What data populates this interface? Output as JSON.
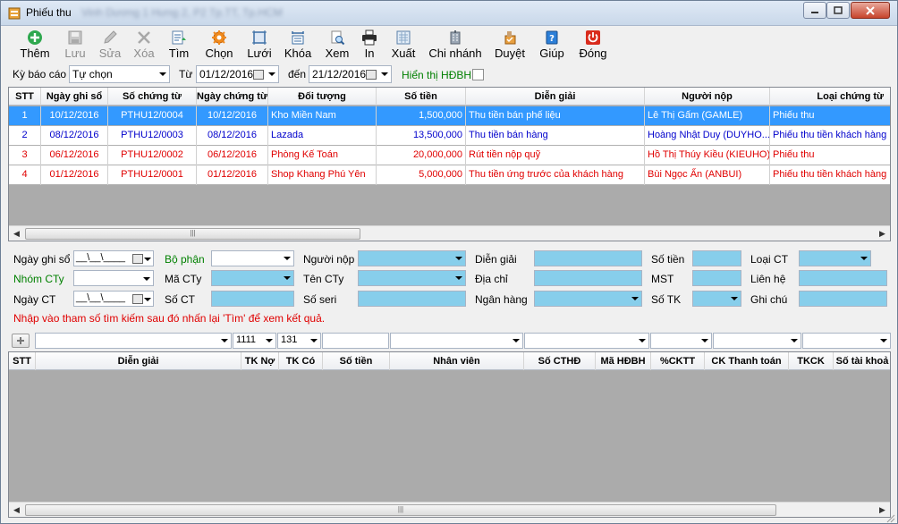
{
  "window": {
    "title": "Phiếu thu",
    "subtitle_blurred": "Vinh Dương 1 Hưng 2, P2 Tp.TT, Tp.HCM"
  },
  "toolbar": [
    {
      "label": "Thêm",
      "icon": "add-icon",
      "enabled": true
    },
    {
      "label": "Lưu",
      "icon": "save-icon",
      "enabled": false
    },
    {
      "label": "Sửa",
      "icon": "edit-icon",
      "enabled": false
    },
    {
      "label": "Xóa",
      "icon": "delete-icon",
      "enabled": false
    },
    {
      "label": "Tìm",
      "icon": "find-icon",
      "enabled": true
    },
    {
      "label": "Chọn",
      "icon": "gear-icon",
      "enabled": true
    },
    {
      "label": "Lưới",
      "icon": "grid-icon",
      "enabled": true
    },
    {
      "label": "Khóa",
      "icon": "lock-icon",
      "enabled": true
    },
    {
      "label": "Xem",
      "icon": "preview-icon",
      "enabled": true
    },
    {
      "label": "In",
      "icon": "printer-icon",
      "enabled": true
    },
    {
      "label": "Xuất",
      "icon": "export-icon",
      "enabled": true
    },
    {
      "label": "Chi nhánh",
      "icon": "branch-icon",
      "enabled": true
    },
    {
      "label": "Duyệt",
      "icon": "approve-icon",
      "enabled": true
    },
    {
      "label": "Giúp",
      "icon": "help-icon",
      "enabled": true
    },
    {
      "label": "Đóng",
      "icon": "power-icon",
      "enabled": true
    }
  ],
  "filter": {
    "period_label": "Kỳ báo cáo",
    "period_value": "Tự chọn",
    "from_label": "Từ",
    "from_value": "01/12/2016",
    "to_label": "đến",
    "to_value": "21/12/2016",
    "show_invoice_label": "Hiển thị HĐBH",
    "show_invoice_checked": false
  },
  "main_grid": {
    "columns": [
      "STT",
      "Ngày ghi sổ",
      "Số chứng từ",
      "Ngày chứng từ",
      "Đối tượng",
      "Số tiền",
      "Diễn giải",
      "Người nộp",
      "Loại chứng từ"
    ],
    "rows": [
      {
        "stt": "1",
        "ngay_ghi_so": "10/12/2016",
        "so_ct": "PTHU12/0004",
        "ngay_ct": "10/12/2016",
        "doi_tuong": "Kho Miền Nam",
        "so_tien": "1,500,000",
        "dien_giai": "Thu tiền bán phế liệu",
        "nguoi_nop": "Lê Thị Gấm (GAMLE)",
        "loai_ct": "Phiếu thu",
        "color": "#ffffff",
        "selected": true
      },
      {
        "stt": "2",
        "ngay_ghi_so": "08/12/2016",
        "so_ct": "PTHU12/0003",
        "ngay_ct": "08/12/2016",
        "doi_tuong": "Lazada",
        "so_tien": "13,500,000",
        "dien_giai": "Thu tiền bán hàng",
        "nguoi_nop": "Hoàng Nhật Duy (DUYHO...",
        "loai_ct": "Phiếu thu tiền khách hàng",
        "color": "#0000cc",
        "selected": false
      },
      {
        "stt": "3",
        "ngay_ghi_so": "06/12/2016",
        "so_ct": "PTHU12/0002",
        "ngay_ct": "06/12/2016",
        "doi_tuong": "Phòng Kế Toán",
        "so_tien": "20,000,000",
        "dien_giai": "Rút tiền nộp quỹ",
        "nguoi_nop": "Hồ Thị Thúy Kiều (KIEUHO)",
        "loai_ct": "Phiếu thu",
        "color": "#e00000",
        "selected": false
      },
      {
        "stt": "4",
        "ngay_ghi_so": "01/12/2016",
        "so_ct": "PTHU12/0001",
        "ngay_ct": "01/12/2016",
        "doi_tuong": "Shop Khang Phú Yên",
        "so_tien": "5,000,000",
        "dien_giai": "Thu tiền ứng trước của khách hàng",
        "nguoi_nop": "Bùi Ngọc Ẩn (ANBUI)",
        "loai_ct": "Phiếu thu tiền khách hàng",
        "color": "#e00000",
        "selected": false
      }
    ]
  },
  "search": {
    "ngay_ghi_so": "Ngày ghi sổ",
    "nhom_cty": "Nhóm CTy",
    "ngay_ct": "Ngày CT",
    "bo_phan": "Bộ phận",
    "ma_cty": "Mã CTy",
    "so_ct": "Số CT",
    "nguoi_nop": "Người nộp",
    "ten_cty": "Tên CTy",
    "so_seri": "Số seri",
    "dien_giai": "Diễn giải",
    "dia_chi": "Địa chỉ",
    "ngan_hang": "Ngân hàng",
    "so_tien": "Số tiền",
    "mst": "MST",
    "so_tk": "Số TK",
    "loai_ct": "Loại CT",
    "lien_he": "Liên hệ",
    "ghi_chu": "Ghi chú",
    "date_mask": "__\\__\\____",
    "hint": "Nhập vào tham số tìm kiếm sau đó nhấn lại 'Tìm' để xem kết quả."
  },
  "detail_bar": {
    "tk_no": "1111",
    "tk_co": "131"
  },
  "detail_grid": {
    "columns": [
      "STT",
      "Diễn giải",
      "TK Nợ",
      "TK Có",
      "Số tiền",
      "Nhân viên",
      "Số CTHĐ",
      "Mã HĐBH",
      "%CKTT",
      "CK Thanh toán",
      "TKCK",
      "Số tài khoả"
    ]
  },
  "colors": {
    "selection": "#3399ff",
    "lookup_field": "#87ceeb",
    "hint_text": "#e00000",
    "green_label": "#008000"
  }
}
